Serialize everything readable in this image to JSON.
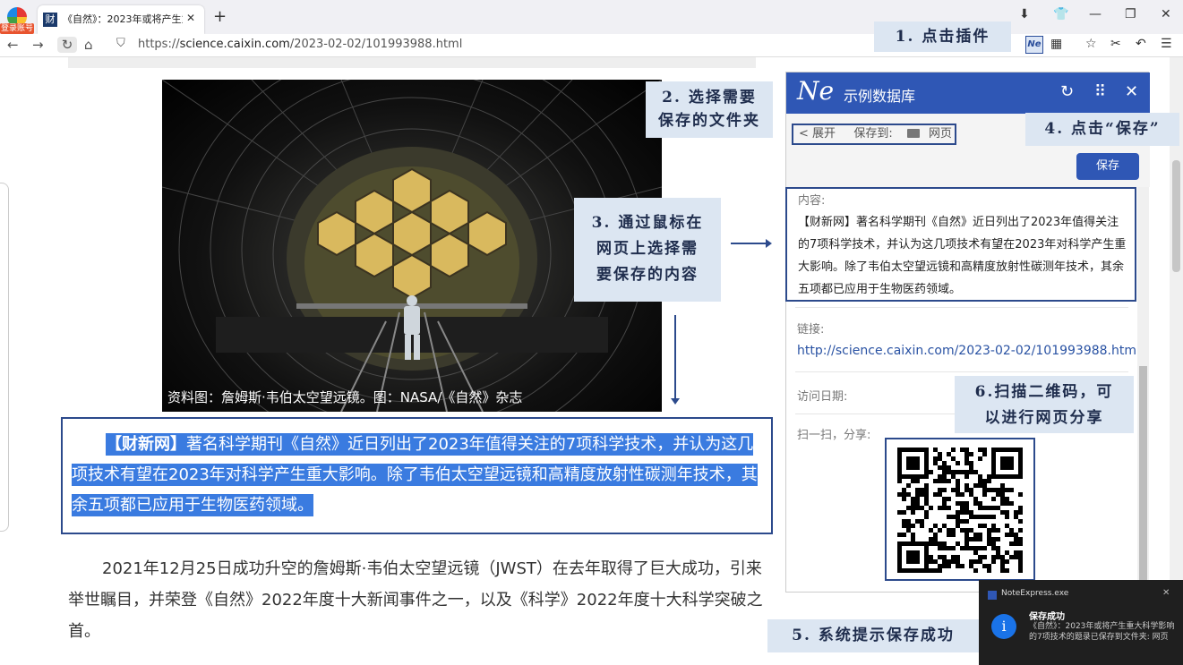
{
  "browser": {
    "login_badge": "登录账号",
    "tab_favicon": "财",
    "tab_title": "《自然》：2023年或将产生重",
    "tab_close": "✕",
    "new_tab": "+",
    "url_prefix": "https://",
    "url_host": "science.caixin.com",
    "url_path": "/2023-02-02/101993988.html"
  },
  "article": {
    "photo_caption": "资料图：詹姆斯·韦伯太空望远镜。图：NASA/《自然》杂志",
    "selected_source": "【财新网】",
    "selected_text": "著名科学期刊《自然》近日列出了2023年值得关注的7项科学技术，并认为这几项技术有望在2023年对科学产生重大影响。除了韦伯太空望远镜和高精度放射性碳测年技术，其余五项都已应用于生物医药领域。",
    "paragraph_2": "2021年12月25日成功升空的詹姆斯·韦伯太空望远镜（JWST）在去年取得了巨大成功，引来举世瞩目，并荣登《自然》2022年度十大新闻事件之一，以及《科学》2022年度十大科学突破之首。"
  },
  "extension": {
    "logo": "Ne",
    "title": "示例数据库",
    "expand_label": "< 展开",
    "save_to_label": "保存到:",
    "folder_name": "网页",
    "save_button": "保存",
    "content_label": "内容:",
    "content_text": "【财新网】著名科学期刊《自然》近日列出了2023年值得关注的7项科学技术，并认为这几项技术有望在2023年对科学产生重大影响。除了韦伯太空望远镜和高精度放射性碳测年技术，其余五项都已应用于生物医药领域。",
    "link_label": "链接:",
    "link_value": "http://science.caixin.com/2023-02-02/101993988.html",
    "date_label": "访问日期:",
    "share_label": "扫一扫，分享:"
  },
  "callouts": {
    "step1": "1. 点击插件",
    "step2_line1": "2. 选择需要",
    "step2_line2": "保存的文件夹",
    "step3_line1": "3. 通过鼠标在",
    "step3_line2": "网页上选择需",
    "step3_line3": "要保存的内容",
    "step4": "4. 点击“保存”",
    "step5": "5. 系统提示保存成功",
    "step6_line1": "6.扫描二维码，可",
    "step6_line2": "以进行网页分享"
  },
  "toast": {
    "app": "NoteExpress.exe",
    "title": "保存成功",
    "body": "《自然》：2023年或将产生重大科学影响的7项技术的题录已保存到文件夹: 网页",
    "icon": "i"
  },
  "colors": {
    "accent": "#2f57b5",
    "annotation_border": "#2c4a8c",
    "callout_bg": "#dce6f2",
    "selection": "#3a7be0"
  }
}
